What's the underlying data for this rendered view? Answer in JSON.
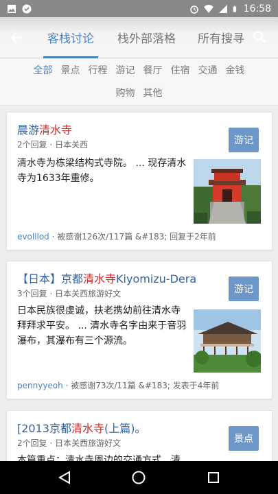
{
  "status_bar": {
    "time": "16:58",
    "left_icons": [
      "image-icon",
      "check-circle-icon"
    ],
    "right_icons": [
      "alarm-icon",
      "wifi-icon",
      "signal-icon",
      "battery-icon"
    ]
  },
  "header": {
    "tabs": [
      {
        "label": "客栈讨论",
        "active": true
      },
      {
        "label": "栈外部落格",
        "active": false
      },
      {
        "label": "所有搜寻",
        "active": false
      }
    ]
  },
  "filters": {
    "row1": [
      "全部",
      "景点",
      "行程",
      "游记",
      "餐厅",
      "住宿",
      "交通",
      "金钱"
    ],
    "row2": [
      "购物",
      "其他"
    ],
    "active": "全部"
  },
  "posts": [
    {
      "title_pre": "晨游",
      "title_hl": "清水寺",
      "title_post": "",
      "meta": "2个回复 · 日本关西",
      "badge": "游记",
      "excerpt": "清水寺为栋梁结构式寺院。 ... 现存清水寺为1633年重修。",
      "user": "evolllod",
      "foot": " · 被感谢126次/117篇 &#183; 回复于2年前"
    },
    {
      "title_pre": "【日本】京都",
      "title_hl": "清水寺",
      "title_post": "Kiyomizu-Dera",
      "meta": "3个回复 · 日本关西旅游好文",
      "badge": "游记",
      "excerpt": "日本民族很虔诚，扶老携幼前往清水寺拜拜求平安。 ... 清水寺名字由来于音羽瀑布，其瀑布有三个源流。",
      "user": "pennyyeoh",
      "foot": " · 被感谢73次/11篇 &#183; 发表于4年前"
    },
    {
      "title_pre": "[2013京都",
      "title_hl": "清水寺",
      "title_post": "(上篇)。",
      "meta": "2个回复 · 日本关西旅游好文",
      "badge": "景点",
      "excerpt": "本篇重点：清水寺周边的交通方式、清水",
      "user": "",
      "foot": ""
    }
  ],
  "colors": {
    "accent": "#4a82c2",
    "highlight": "#c62b2b",
    "badge": "#6d97c9"
  }
}
